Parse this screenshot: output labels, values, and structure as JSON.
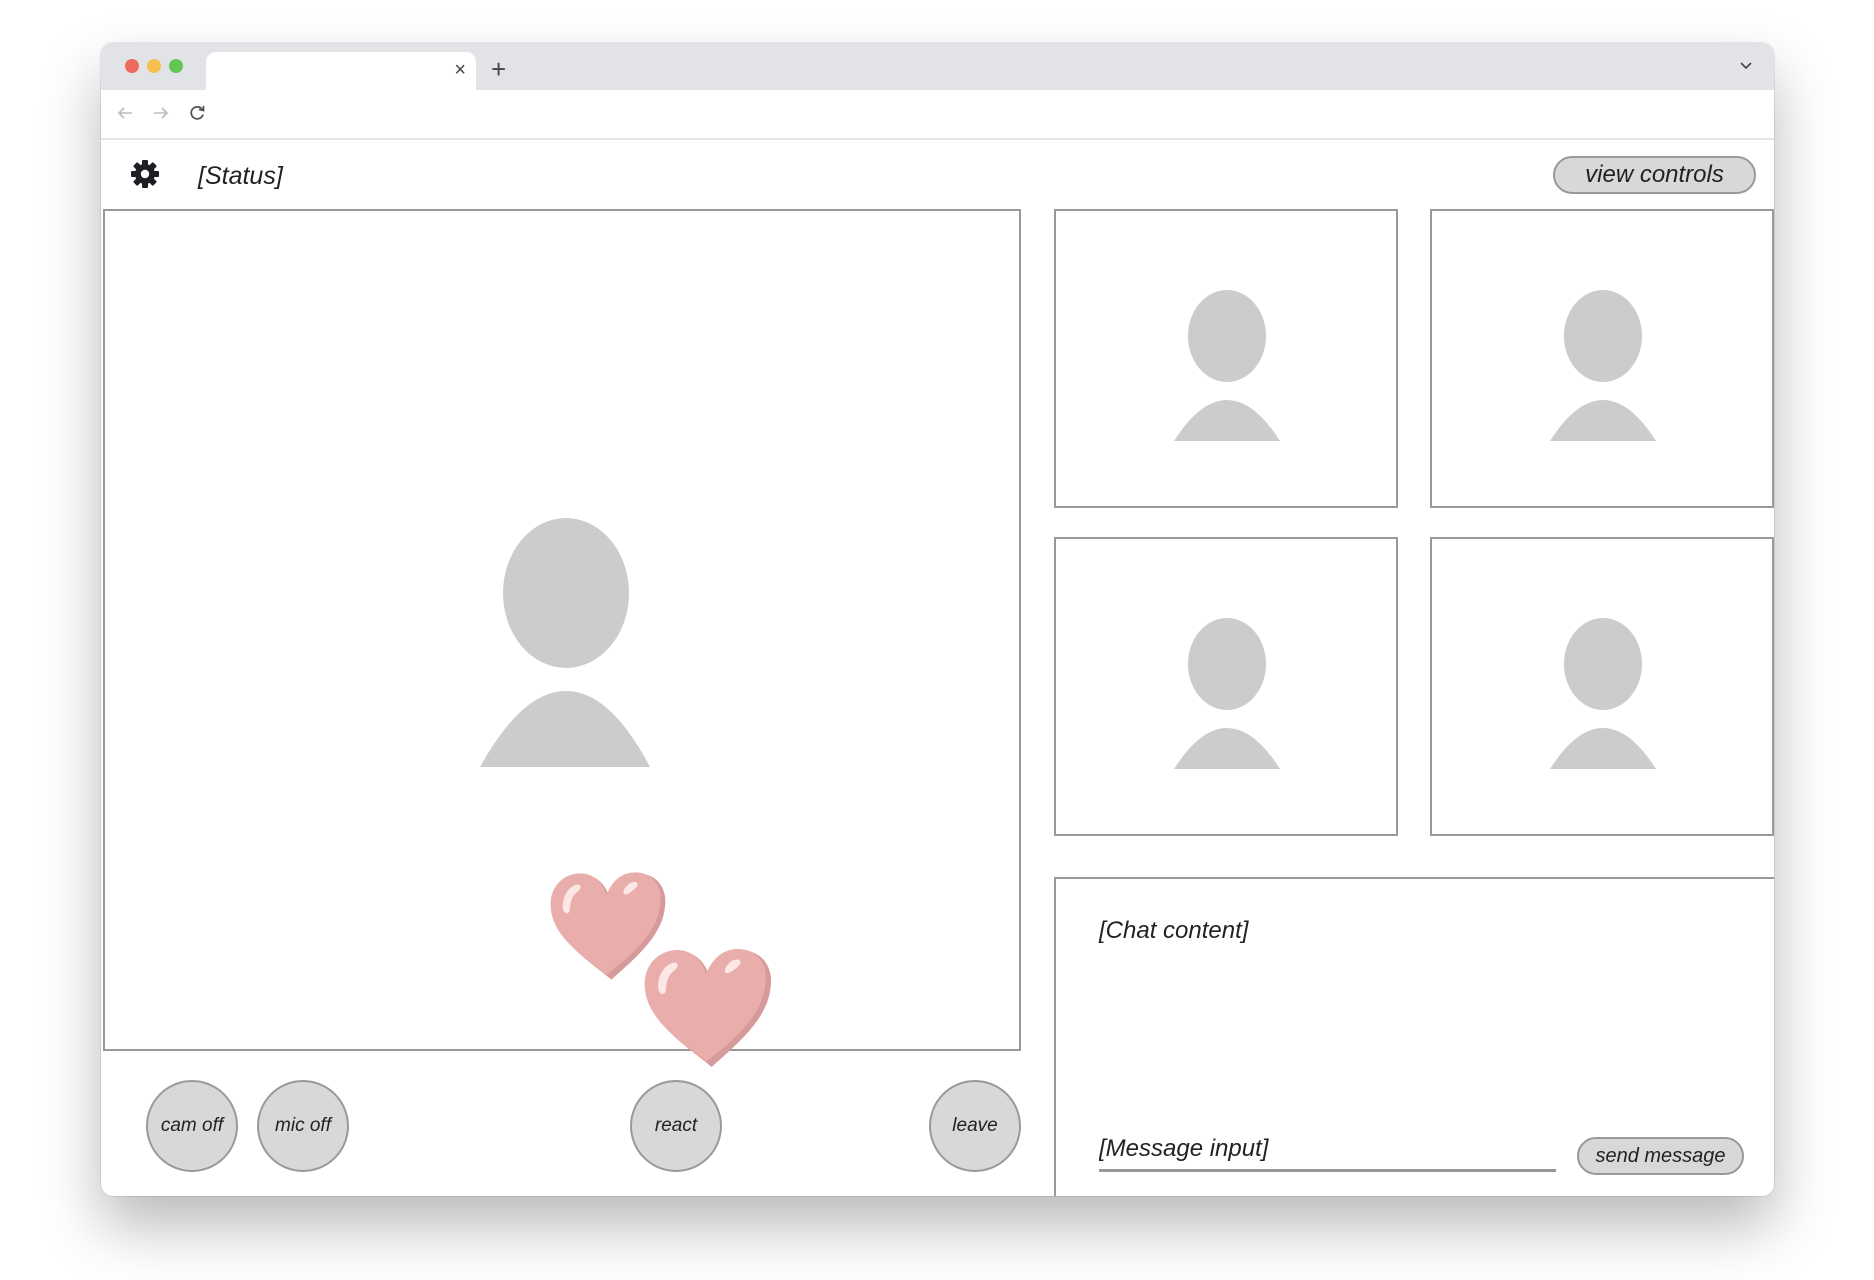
{
  "browser": {
    "tab": {
      "title": "",
      "close_icon": "×"
    },
    "new_tab_icon": "+",
    "nav": {
      "back": "back-arrow-icon",
      "forward": "forward-arrow-icon",
      "reload": "reload-icon"
    },
    "traffic_lights": {
      "close": "#ee6a5f",
      "minimize": "#f5bf4f",
      "maximize": "#62c655"
    }
  },
  "header": {
    "settings_icon": "gear-icon",
    "status": "[Status]",
    "view_controls_label": "view controls"
  },
  "main_video": {
    "participant_placeholder": "person-avatar"
  },
  "participants": [
    {
      "placeholder": "person-avatar"
    },
    {
      "placeholder": "person-avatar"
    },
    {
      "placeholder": "person-avatar"
    },
    {
      "placeholder": "person-avatar"
    }
  ],
  "reactions": [
    {
      "type": "heart",
      "color": "#e9aeac"
    },
    {
      "type": "heart",
      "color": "#e9aeac"
    }
  ],
  "controls": {
    "cam_off": "cam off",
    "mic_off": "mic off",
    "react": "react",
    "leave": "leave"
  },
  "chat": {
    "content": "[Chat content]",
    "input_value": "",
    "input_placeholder": "[Message input]",
    "send_label": "send message"
  },
  "colors": {
    "button_fill": "#d8d8d8",
    "border": "#999999",
    "avatar": "#cccccc",
    "heart": "#e9aeac"
  }
}
